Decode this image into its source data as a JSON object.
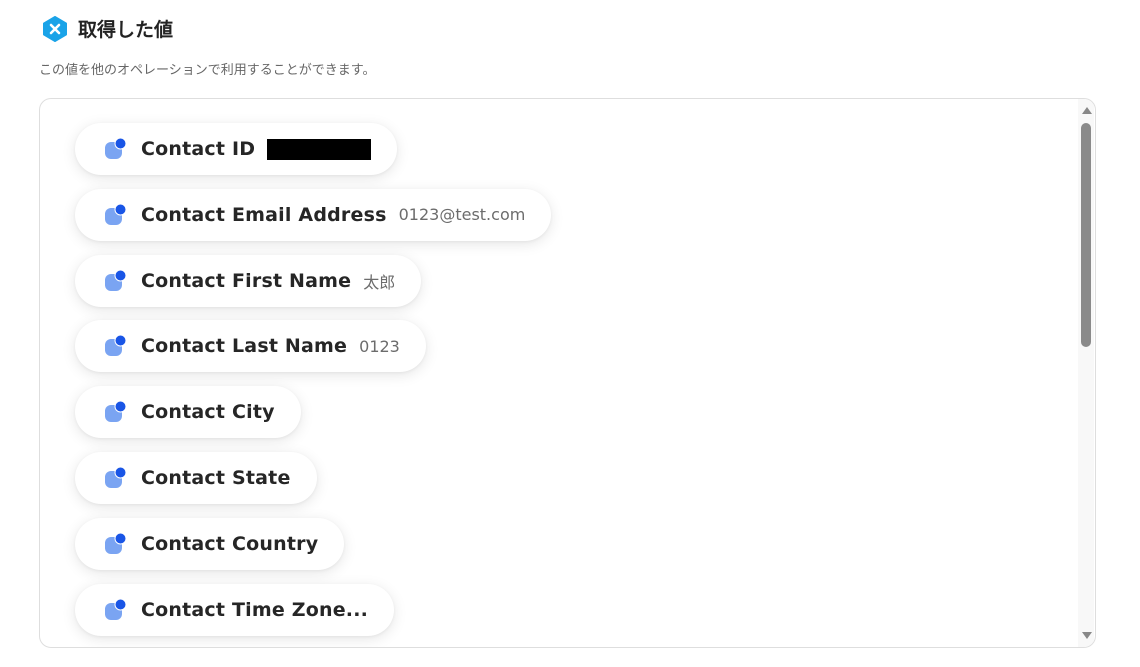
{
  "header": {
    "title": "取得した値",
    "subtitle": "この値を他のオペレーションで利用することができます。"
  },
  "outputs": [
    {
      "label": "Contact ID",
      "value": "",
      "redacted": true
    },
    {
      "label": "Contact Email Address",
      "value": "0123@test.com"
    },
    {
      "label": "Contact First Name",
      "value": "太郎"
    },
    {
      "label": "Contact Last Name",
      "value": "0123"
    },
    {
      "label": "Contact City",
      "value": ""
    },
    {
      "label": "Contact State",
      "value": ""
    },
    {
      "label": "Contact Country",
      "value": ""
    },
    {
      "label": "Contact Time Zone...",
      "value": ""
    }
  ],
  "colors": {
    "accent": "#1aa3e8",
    "variable_icon": "#7aa4f2",
    "variable_dot": "#1955e6"
  }
}
